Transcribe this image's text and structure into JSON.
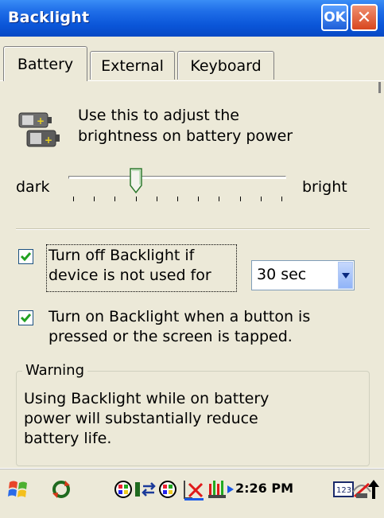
{
  "window": {
    "title": "Backlight",
    "ok_label": "OK",
    "close_label": "✕"
  },
  "tabs": [
    {
      "label": "Battery",
      "active": true
    },
    {
      "label": "External",
      "active": false
    },
    {
      "label": "Keyboard",
      "active": false
    }
  ],
  "battery": {
    "icon": "battery-icon",
    "description_line1": "Use this to adjust the",
    "description_line2": "brightness on battery power",
    "slider": {
      "min_label": "dark",
      "max_label": "bright",
      "value": 0.3,
      "ticks": 11
    },
    "auto_off": {
      "checked": true,
      "line1": "Turn off Backlight if",
      "line2": "device is not used for",
      "selected": "30 sec"
    },
    "auto_on": {
      "checked": true,
      "line1": "Turn on Backlight when a button is",
      "line2": "pressed or the screen is tapped."
    },
    "warning": {
      "title": "Warning",
      "line1": "Using Backlight while on battery",
      "line2": "power will substantially reduce",
      "line3": "battery life."
    }
  },
  "taskbar": {
    "clock": "2:26 PM",
    "icons": [
      "start-flag-icon",
      "sync-icon",
      "network-icon",
      "connection-icon",
      "network-icon",
      "no-connection-icon",
      "signal-icon",
      "play-arrow-icon",
      "input-panel-icon",
      "wireless-icon",
      "up-arrow-icon"
    ]
  },
  "colors": {
    "title_bar": "#0a55d8",
    "ok_button": "#1f5fd8",
    "close_button": "#d8461e",
    "check": "#21a121",
    "background": "#ece9d8"
  }
}
